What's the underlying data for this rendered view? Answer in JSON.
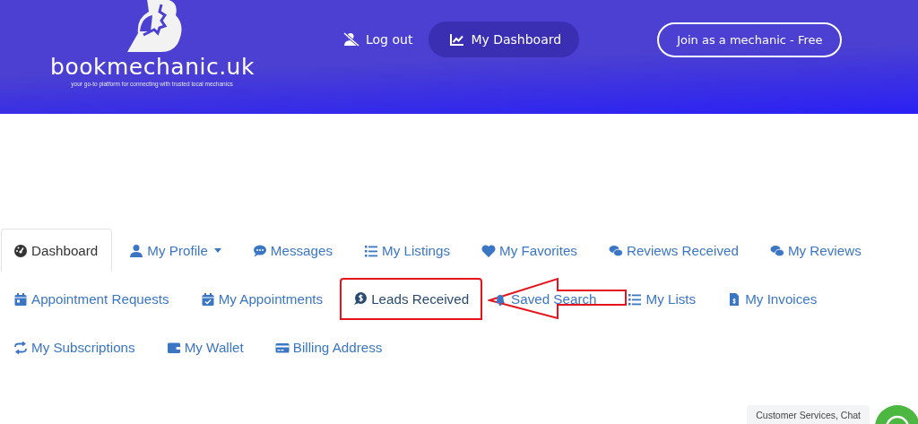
{
  "header": {
    "logo": {
      "name": "bookmechanic.uk",
      "tagline": "your go-to platform for connecting with trusted local mechanics"
    },
    "nav": [
      {
        "label": "Log out",
        "kind": "link",
        "selected": false
      },
      {
        "label": "My Dashboard",
        "kind": "link",
        "selected": true
      },
      {
        "label": "Join as a mechanic - Free",
        "kind": "outline"
      }
    ]
  },
  "tab_rows": [
    {
      "tabs": [
        {
          "label": "Dashboard",
          "selected": true,
          "dropdown": false,
          "annotated": false
        },
        {
          "label": "My Profile",
          "selected": false,
          "dropdown": true,
          "annotated": false
        },
        {
          "label": "Messages",
          "selected": false,
          "dropdown": false,
          "annotated": false
        },
        {
          "label": "My Listings",
          "selected": false,
          "dropdown": false,
          "annotated": false
        },
        {
          "label": "My Favorites",
          "selected": false,
          "dropdown": false,
          "annotated": false
        },
        {
          "label": "Reviews Received",
          "selected": false,
          "dropdown": false,
          "annotated": false
        },
        {
          "label": "My Reviews",
          "selected": false,
          "dropdown": false,
          "annotated": false
        }
      ]
    },
    {
      "tabs": [
        {
          "label": "Appointment Requests",
          "selected": false,
          "dropdown": false,
          "annotated": false
        },
        {
          "label": "My Appointments",
          "selected": false,
          "dropdown": false,
          "annotated": false
        },
        {
          "label": "Leads Received",
          "selected": false,
          "dropdown": false,
          "annotated": true
        },
        {
          "label": "Saved Search",
          "selected": false,
          "dropdown": false,
          "annotated": false
        },
        {
          "label": "My Lists",
          "selected": false,
          "dropdown": false,
          "annotated": false
        },
        {
          "label": "My Invoices",
          "selected": false,
          "dropdown": false,
          "annotated": false
        }
      ]
    },
    {
      "tabs": [
        {
          "label": "My Subscriptions",
          "selected": false,
          "dropdown": false,
          "annotated": false
        },
        {
          "label": "My Wallet",
          "selected": false,
          "dropdown": false,
          "annotated": false
        },
        {
          "label": "Billing Address",
          "selected": false,
          "dropdown": false,
          "annotated": false
        }
      ]
    }
  ],
  "chat_widget": {
    "label": "Customer Services, Chat"
  }
}
